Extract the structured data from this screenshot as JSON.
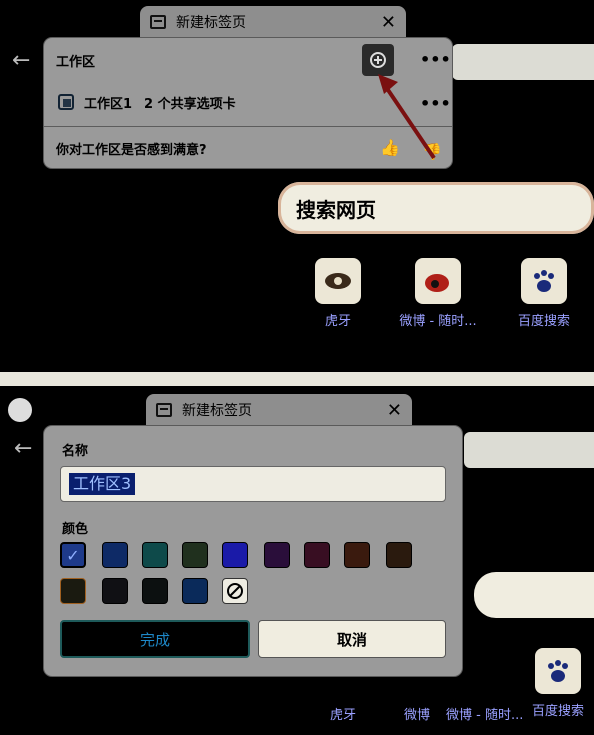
{
  "top": {
    "tab_title": "新建标签页",
    "workspace_panel": {
      "title": "工作区",
      "item_name": "工作区1",
      "item_shared": "2 个共享选项卡",
      "feedback": "你对工作区是否感到满意?"
    },
    "search_placeholder": "搜索网页",
    "shortcuts": [
      {
        "label": "虎牙",
        "icon": "eye-icon"
      },
      {
        "label": "微博 - 随时...",
        "icon": "weibo-icon"
      },
      {
        "label": "百度搜索",
        "icon": "paw-icon"
      }
    ]
  },
  "bottom": {
    "tab_title": "新建标签页",
    "dialog": {
      "name_label": "名称",
      "name_value": "工作区3",
      "color_label": "颜色",
      "colors": [
        "#1e3a8a",
        "#0e2a66",
        "#0e4a4a",
        "#20301e",
        "#1a1aa8",
        "#2a0e3a",
        "#380e22",
        "#3a1a0e",
        "#2a1a0e",
        "#1a1a10",
        "#101014",
        "#0c1010",
        "#0a2a5a",
        "none"
      ],
      "done": "完成",
      "cancel": "取消"
    },
    "shortcuts": [
      {
        "label": "虎牙"
      },
      {
        "label": "微博"
      },
      {
        "label": "微博 - 随时..."
      },
      {
        "label": "百度搜索",
        "icon": "paw-icon"
      }
    ]
  }
}
